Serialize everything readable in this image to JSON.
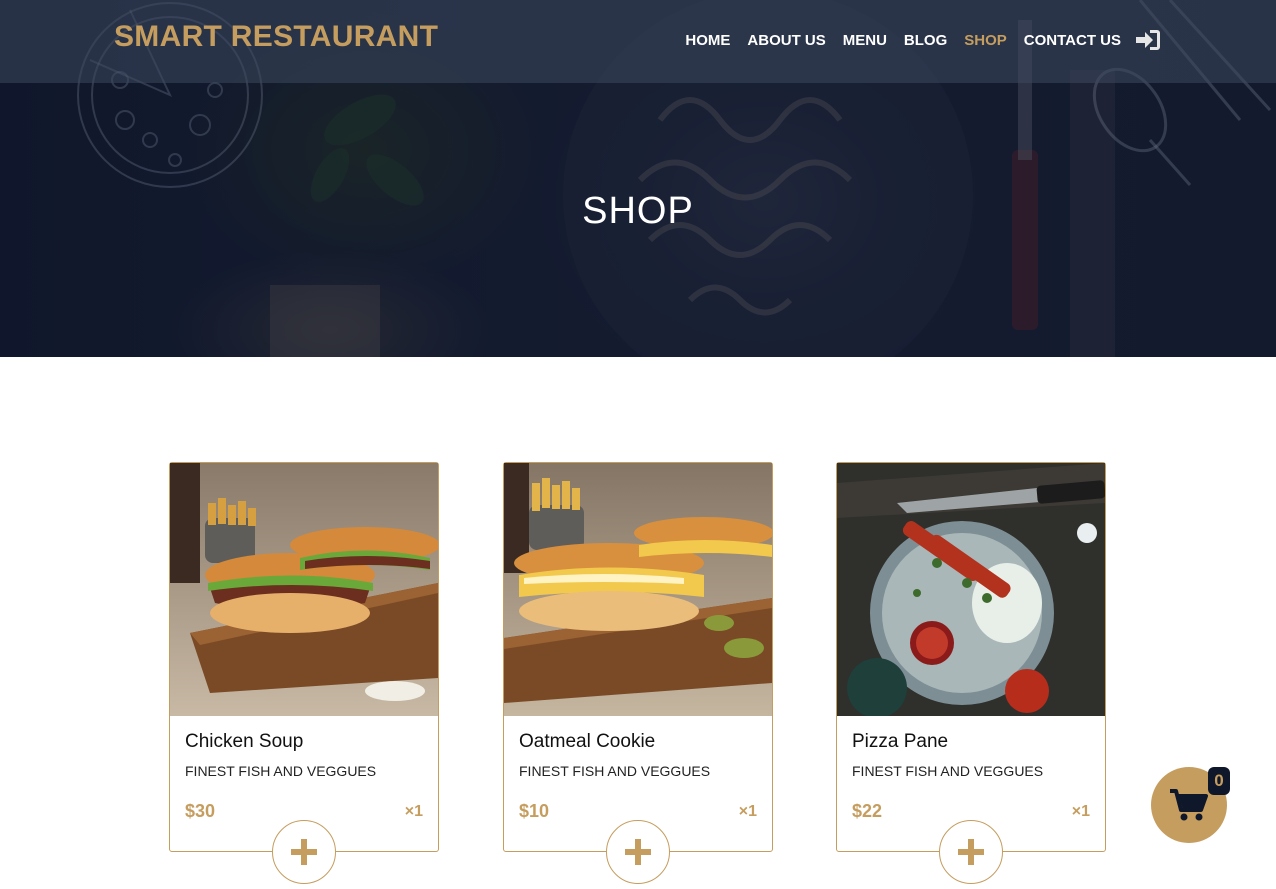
{
  "brand": "SMART RESTAURANT",
  "nav": {
    "items": [
      "HOME",
      "ABOUT US",
      "MENU",
      "BLOG",
      "SHOP",
      "CONTACT US"
    ],
    "active": "SHOP",
    "login_icon": "sign-in-icon"
  },
  "hero": {
    "title": "SHOP"
  },
  "products": [
    {
      "name": "Chicken Soup",
      "description": "FINEST FISH AND VEGGUES",
      "price": "$30",
      "quantity": "×1",
      "add_icon": "plus-icon"
    },
    {
      "name": "Oatmeal Cookie",
      "description": "FINEST FISH AND VEGGUES",
      "price": "$10",
      "quantity": "×1",
      "add_icon": "plus-icon"
    },
    {
      "name": "Pizza Pane",
      "description": "FINEST FISH AND VEGGUES",
      "price": "$22",
      "quantity": "×1",
      "add_icon": "plus-icon"
    }
  ],
  "cart": {
    "icon": "shopping-cart-icon",
    "count": "0"
  },
  "colors": {
    "accent": "#c59d5f",
    "navy": "#0f172a",
    "text": "#111111"
  }
}
